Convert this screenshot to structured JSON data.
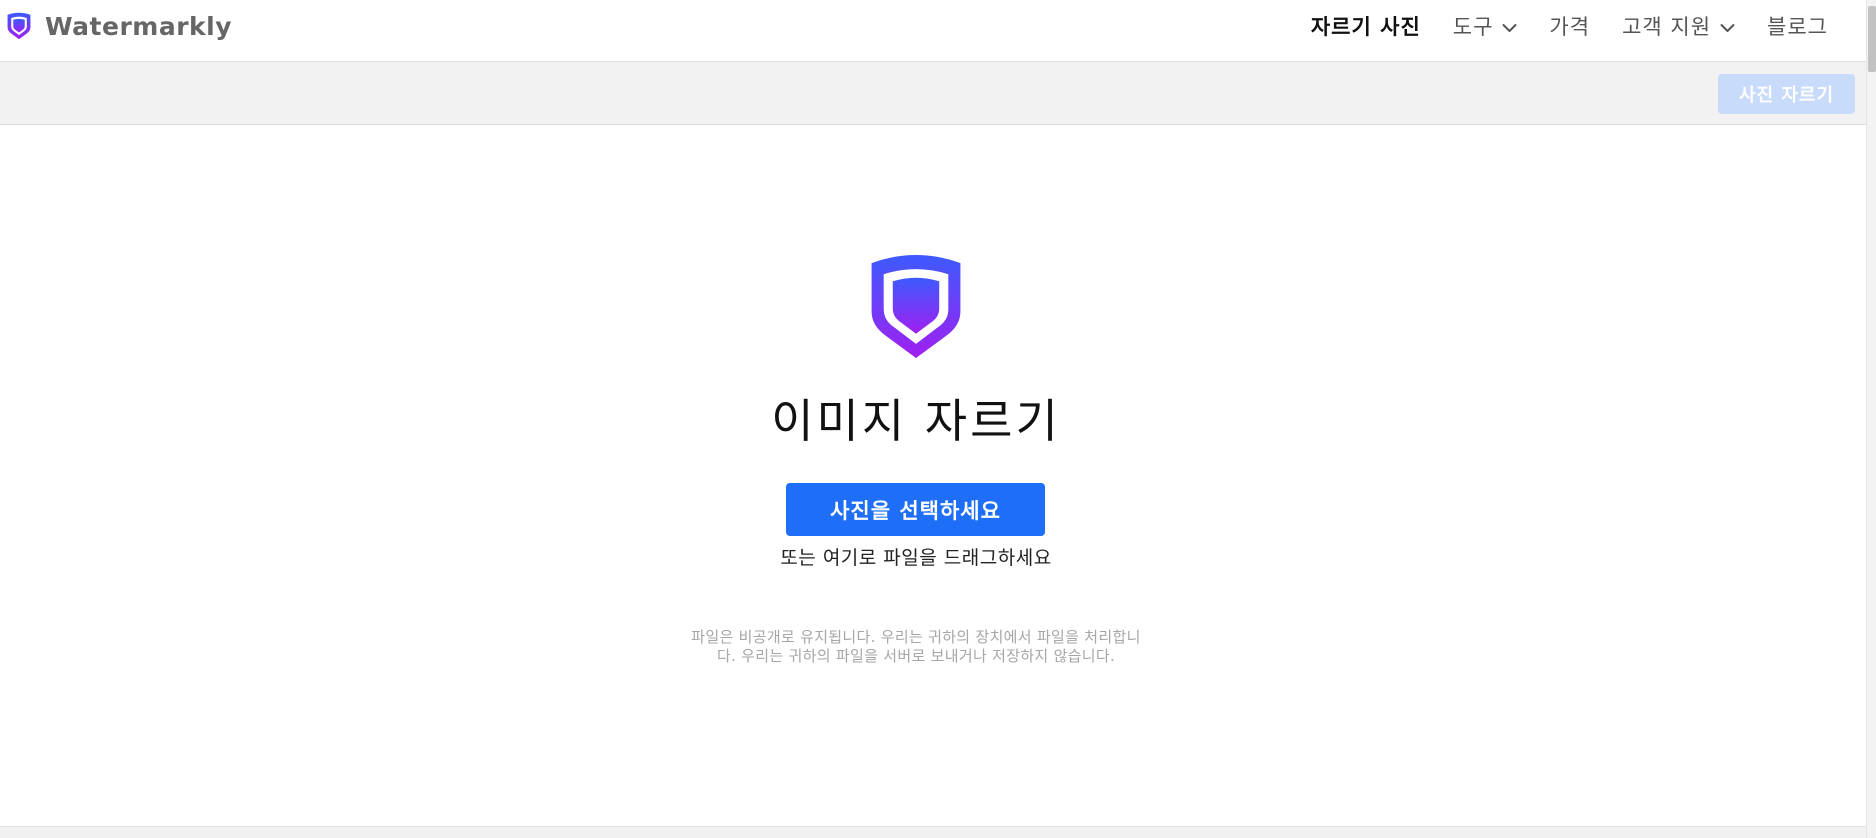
{
  "brand": {
    "name": "Watermarkly",
    "logo_icon": "shield-logo-icon"
  },
  "nav": {
    "items": [
      {
        "label": "자르기 사진",
        "active": true,
        "has_dropdown": false
      },
      {
        "label": "도구",
        "active": false,
        "has_dropdown": true
      },
      {
        "label": "가격",
        "active": false,
        "has_dropdown": false
      },
      {
        "label": "고객 지원",
        "active": false,
        "has_dropdown": true
      },
      {
        "label": "블로그",
        "active": false,
        "has_dropdown": false
      }
    ]
  },
  "toolbar": {
    "crop_button_label": "사진 자르기",
    "crop_button_enabled": false
  },
  "main": {
    "hero_icon": "shield-logo-icon",
    "headline": "이미지 자르기",
    "select_button_label": "사진을 선택하세요",
    "drag_hint": "또는 여기로 파일을 드래그하세요",
    "privacy_note": "파일은 비공개로 유지됩니다. 우리는 귀하의 장치에서 파일을 처리합니다. 우리는 귀하의 파일을 서버로 보내거나 저장하지 않습니다."
  },
  "colors": {
    "accent": "#1e6ef8",
    "accent_disabled": "#c8dbfb",
    "logo_gradient_start": "#3d5afe",
    "logo_gradient_end": "#a020f0",
    "toolbar_bg": "#f2f2f2"
  }
}
